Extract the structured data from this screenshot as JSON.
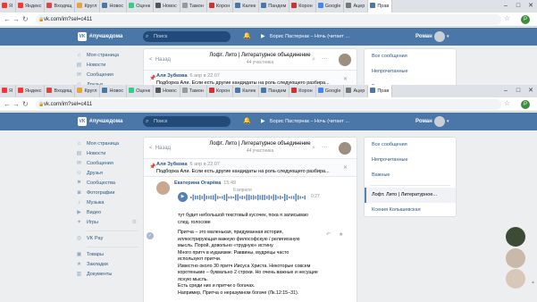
{
  "browser": {
    "tabs": [
      "Я",
      "Яндекс",
      "Входящ",
      "Кругл",
      "Новос",
      "Оценк",
      "Новос",
      "Тамон",
      "Корон",
      "Калек",
      "Пандем",
      "Корон",
      "Google",
      "Ацер",
      "Прав"
    ],
    "address": "vk.com/im?sel=c411",
    "profile_initial": "Р"
  },
  "vk_header": {
    "brand": "#лучшедома",
    "search_placeholder": "Поиск",
    "now_playing": "Борис Пастернак – Ночь (читает ...",
    "user_name": "Роман"
  },
  "left_nav": {
    "items": [
      "Моя страница",
      "Новости",
      "Сообщения",
      "Друзья",
      "Сообщества",
      "Фотографии",
      "Музыка",
      "Видео",
      "Игры"
    ],
    "secondary": [
      "VK Pay"
    ],
    "tertiary": [
      "Товары",
      "Закладки",
      "Документы"
    ]
  },
  "chat": {
    "back_label": "Назад",
    "title": "Лофт. Лито | Литературное объединение",
    "members": "44 участника",
    "pinned": {
      "author": "Аля Зубкова",
      "time": "6 апр в 22:07",
      "text": "Подборка Али. Если есть другие кандидаты на роль следующего разбира..."
    },
    "message": {
      "author": "Екатерина Огарёва",
      "time": "15:49",
      "date": "6 апреля",
      "voice_duration": "0:27",
      "caption": "тут будет небольшой текстовый кусочек, пока я записываю след. голосове",
      "body": [
        "Притча – это маленькая, придуманная история,",
        "иллюстрирующая важную философскую / религиозную",
        "мысль. Порой, довольно «трудную» истину.",
        "Много притч в иудаизме. Раввины, мудрецы часто",
        "используют притчи.",
        "Известно около 30 притч Иисуса Христа. Некоторые совсем",
        "коротенькие – буквально 2 строки. Но очень важные и несущие",
        "ясную мысль.",
        "Есть среди них и притчи о богачах.",
        "Например, Притча о неразумном богаче (Лк.12:15–31)."
      ]
    }
  },
  "right_panel": {
    "filters": [
      "Все сообщения",
      "Непрочитанные",
      "Важные"
    ],
    "conversations": [
      "Лофт. Лито | Литературное...",
      "Ксения Колышевская"
    ]
  },
  "colors": {
    "vk_blue": "#4a76a8",
    "link_blue": "#2a5885",
    "accent": "#5181b8"
  }
}
